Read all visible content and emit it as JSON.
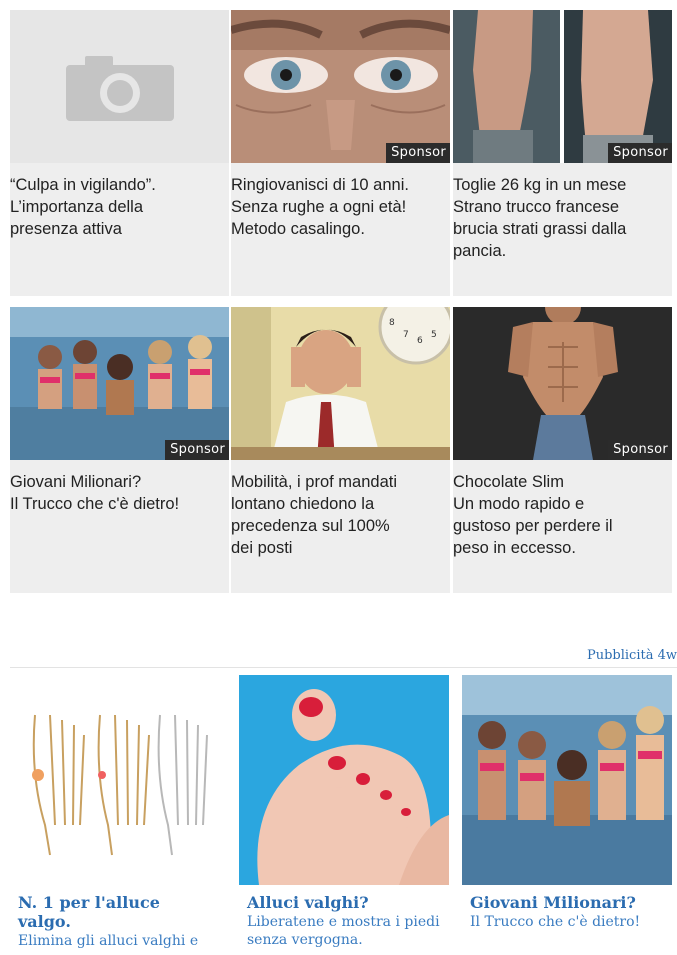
{
  "grid": {
    "sponsor_label": "Sponsor",
    "cards": [
      {
        "lines": [
          "“Culpa in vigilando”.",
          "L’importanza della",
          "presenza attiva"
        ],
        "sponsored": false,
        "image": "camera-placeholder-icon"
      },
      {
        "lines": [
          "Ringiovanisci di 10 anni.",
          "Senza rughe a ogni età!",
          "Metodo casalingo."
        ],
        "sponsored": true,
        "image": "eyes-closeup-image"
      },
      {
        "lines": [
          "Toglie 26 kg in un mese",
          "Strano trucco francese",
          "brucia strati grassi dalla",
          "pancia."
        ],
        "sponsored": true,
        "image": "torso-comparison-image"
      },
      {
        "lines": [
          "Giovani Milionari?",
          "Il Trucco che c'è dietro!"
        ],
        "sponsored": true,
        "image": "hot-tub-group-image"
      },
      {
        "lines": [
          "Mobilità, i prof mandati",
          "lontano chiedono la",
          "precedenza sul 100%",
          "dei posti"
        ],
        "sponsored": false,
        "image": "stressed-man-clock-image"
      },
      {
        "lines": [
          "Chocolate Slim",
          "Un modo rapido e",
          "gustoso per perdere il",
          "peso in eccesso."
        ],
        "sponsored": true,
        "image": "shirtless-man-image"
      }
    ]
  },
  "ad_network": {
    "label": "Pubblicità 4w",
    "items": [
      {
        "title": "N. 1 per l'alluce valgo.",
        "desc": "Elimina gli alluci valghi e",
        "image": "foot-bones-diagram"
      },
      {
        "title": "Alluci valghi?",
        "desc": "Liberatene e mostra i piedi senza vergogna.",
        "image": "painted-toes-image"
      },
      {
        "title": "Giovani Milionari?",
        "desc": "Il Trucco che c'è dietro!",
        "image": "hot-tub-group-image"
      }
    ]
  }
}
